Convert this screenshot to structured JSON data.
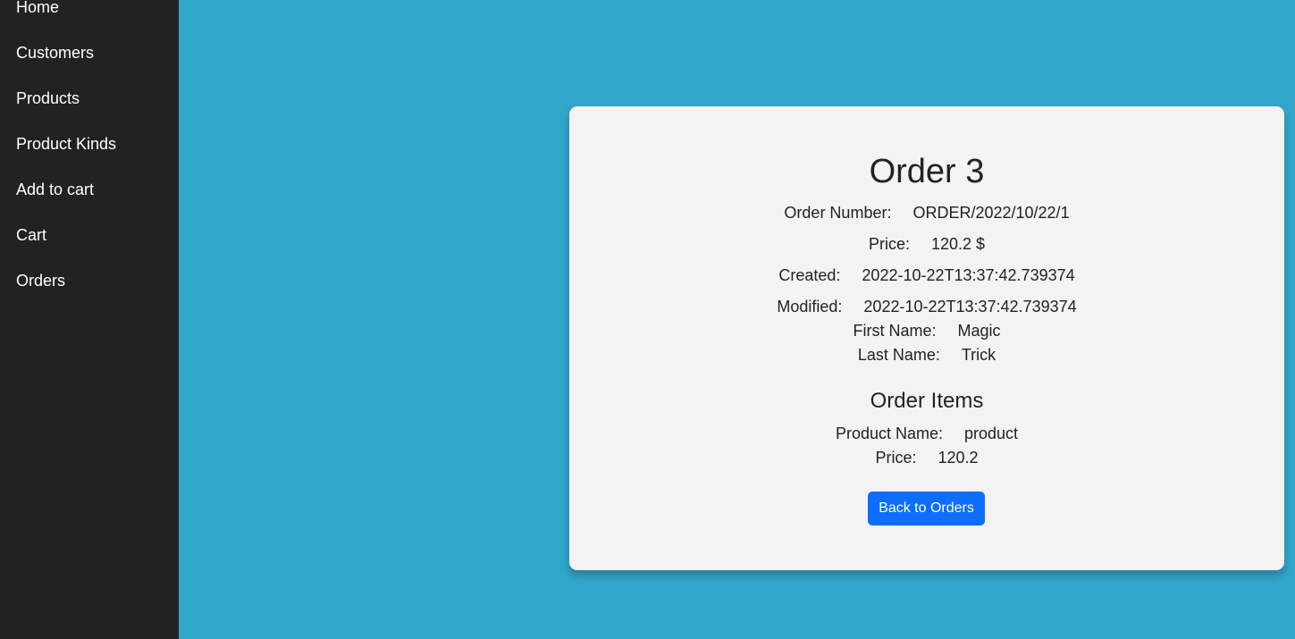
{
  "sidebar": {
    "items": [
      {
        "label": "Home"
      },
      {
        "label": "Customers"
      },
      {
        "label": "Products"
      },
      {
        "label": "Product Kinds"
      },
      {
        "label": "Add to cart"
      },
      {
        "label": "Cart"
      },
      {
        "label": "Orders"
      }
    ]
  },
  "order": {
    "title": "Order 3",
    "order_number": {
      "label": "Order Number:",
      "value": "ORDER/2022/10/22/1"
    },
    "price": {
      "label": "Price:",
      "value": "120.2 $"
    },
    "created": {
      "label": "Created:",
      "value": "2022-10-22T13:37:42.739374"
    },
    "modified": {
      "label": "Modified:",
      "value": "2022-10-22T13:37:42.739374"
    },
    "first_name": {
      "label": "First Name:",
      "value": "Magic"
    },
    "last_name": {
      "label": "Last Name:",
      "value": "Trick"
    }
  },
  "order_items": {
    "title": "Order Items",
    "items": [
      {
        "product_name": {
          "label": "Product Name:",
          "value": "product"
        },
        "price": {
          "label": "Price:",
          "value": "120.2"
        }
      }
    ]
  },
  "back_button": {
    "label": "Back to Orders"
  },
  "colors": {
    "background": "#31a7cb",
    "sidebar": "#222222",
    "card": "#f3f3f3",
    "button": "#0d6efd"
  }
}
